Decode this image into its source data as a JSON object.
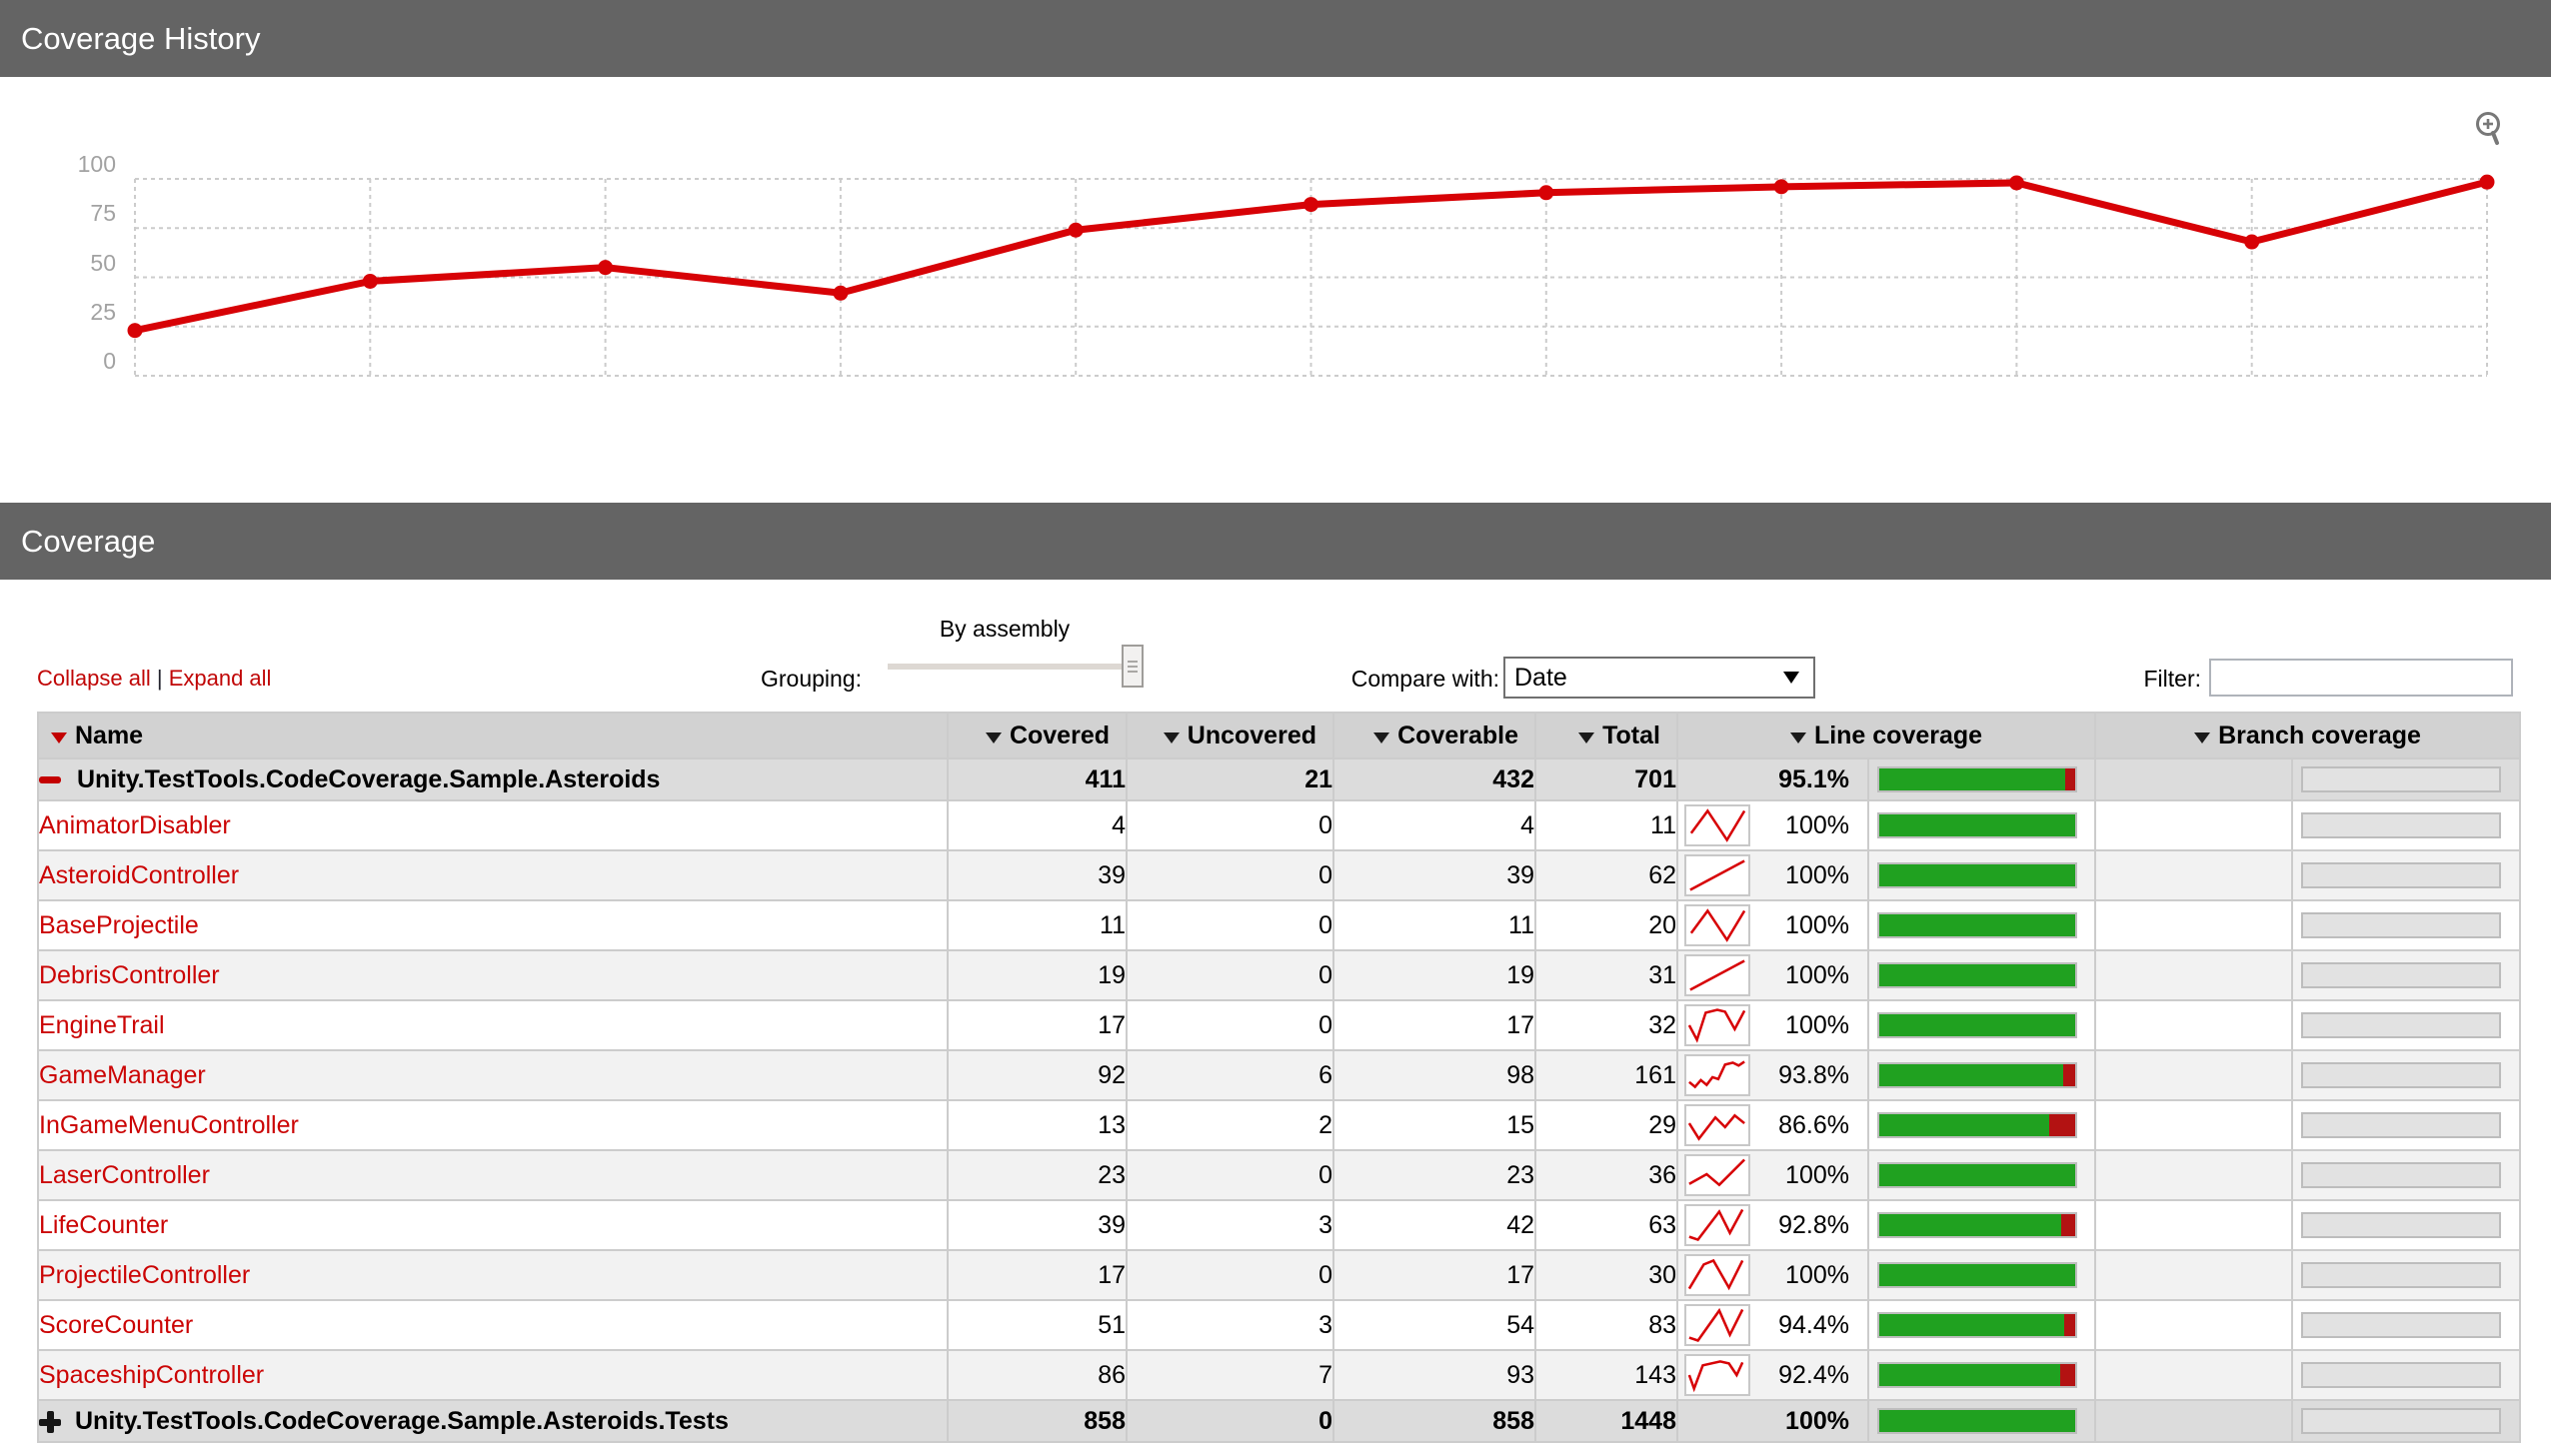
{
  "history_section": {
    "title": "Coverage History",
    "zoom_icon": "magnifier-plus"
  },
  "chart_data": {
    "type": "line",
    "title": "Coverage History",
    "series": [
      {
        "name": "coverage-percent",
        "values": [
          23,
          48,
          55,
          42,
          74,
          87,
          93,
          96,
          98,
          68,
          98.4
        ]
      }
    ],
    "yticks": [
      100,
      75,
      50,
      25,
      0
    ],
    "ylim": [
      0,
      100
    ],
    "grid": "dashed",
    "legend": "none",
    "line_color": "#d70206"
  },
  "coverage_section": {
    "title": "Coverage"
  },
  "controls": {
    "collapse_all": "Collapse all",
    "separator": "|",
    "expand_all": "Expand all",
    "grouping_label": "Grouping:",
    "grouping_value": "By assembly",
    "compare_label": "Compare with:",
    "compare_value": "Date",
    "filter_label": "Filter:",
    "filter_value": ""
  },
  "colors": {
    "accent_red": "#cb0505",
    "bar_green": "#20a120",
    "bar_red": "#b31212",
    "header_gray": "#646464"
  },
  "table": {
    "columns": [
      {
        "label": "Name",
        "sorted": true,
        "colspan": 1,
        "align": "left"
      },
      {
        "label": "Covered",
        "sorted": false,
        "colspan": 1,
        "align": "right"
      },
      {
        "label": "Uncovered",
        "sorted": false,
        "colspan": 1,
        "align": "right"
      },
      {
        "label": "Coverable",
        "sorted": false,
        "colspan": 1,
        "align": "right"
      },
      {
        "label": "Total",
        "sorted": false,
        "colspan": 1,
        "align": "right"
      },
      {
        "label": "Line coverage",
        "sorted": false,
        "colspan": 2,
        "align": "center"
      },
      {
        "label": "Branch coverage",
        "sorted": false,
        "colspan": 2,
        "align": "center"
      }
    ],
    "rows": [
      {
        "name": "Unity.TestTools.CodeCoverage.Sample.Asteroids",
        "type": "assembly",
        "icon": "minus",
        "covered": "411",
        "uncovered": "21",
        "coverable": "432",
        "total": "701",
        "line_coverage": "95.1%",
        "line_pct": 95.1,
        "spark": null,
        "branch_pct": null
      },
      {
        "name": "AnimatorDisabler",
        "type": "class",
        "icon": null,
        "covered": "4",
        "uncovered": "0",
        "coverable": "4",
        "total": "11",
        "line_coverage": "100%",
        "line_pct": 100,
        "spark": "5,27 22,4 42,34 60,4",
        "branch_pct": null
      },
      {
        "name": "AsteroidController",
        "type": "class",
        "icon": null,
        "covered": "39",
        "uncovered": "0",
        "coverable": "39",
        "total": "62",
        "line_coverage": "100%",
        "line_pct": 100,
        "spark": "4,34 60,4",
        "branch_pct": null
      },
      {
        "name": "BaseProjectile",
        "type": "class",
        "icon": null,
        "covered": "11",
        "uncovered": "0",
        "coverable": "11",
        "total": "20",
        "line_coverage": "100%",
        "line_pct": 100,
        "spark": "5,27 22,4 42,34 60,4",
        "branch_pct": null
      },
      {
        "name": "DebrisController",
        "type": "class",
        "icon": null,
        "covered": "19",
        "uncovered": "0",
        "coverable": "19",
        "total": "31",
        "line_coverage": "100%",
        "line_pct": 100,
        "spark": "4,34 60,4",
        "branch_pct": null
      },
      {
        "name": "EngineTrail",
        "type": "class",
        "icon": null,
        "covered": "17",
        "uncovered": "0",
        "coverable": "17",
        "total": "32",
        "line_coverage": "100%",
        "line_pct": 100,
        "spark": "3,19 11,34 20,6 32,3 40,5 50,23 60,4",
        "branch_pct": null
      },
      {
        "name": "GameManager",
        "type": "class",
        "icon": null,
        "covered": "92",
        "uncovered": "6",
        "coverable": "98",
        "total": "161",
        "line_coverage": "93.8%",
        "line_pct": 93.8,
        "spark": "3,26 9,31 15,24 21,29 27,21 33,23 40,8 48,6 54,9 60,5",
        "branch_pct": null
      },
      {
        "name": "InGameMenuController",
        "type": "class",
        "icon": null,
        "covered": "13",
        "uncovered": "2",
        "coverable": "15",
        "total": "29",
        "line_coverage": "86.6%",
        "line_pct": 86.6,
        "spark": "3,17 13,33 30,11 40,21 50,9 60,17",
        "branch_pct": null
      },
      {
        "name": "LaserController",
        "type": "class",
        "icon": null,
        "covered": "23",
        "uncovered": "0",
        "coverable": "23",
        "total": "36",
        "line_coverage": "100%",
        "line_pct": 100,
        "spark": "3,28 21,18 34,29 60,3",
        "branch_pct": null
      },
      {
        "name": "LifeCounter",
        "type": "class",
        "icon": null,
        "covered": "39",
        "uncovered": "3",
        "coverable": "42",
        "total": "63",
        "line_coverage": "92.8%",
        "line_pct": 92.8,
        "spark": "3,31 12,34 34,5 45,27 58,3",
        "branch_pct": null
      },
      {
        "name": "ProjectileController",
        "type": "class",
        "icon": null,
        "covered": "17",
        "uncovered": "0",
        "coverable": "17",
        "total": "30",
        "line_coverage": "100%",
        "line_pct": 100,
        "spark": "3,33 18,8 28,4 44,32 58,4",
        "branch_pct": null
      },
      {
        "name": "ScoreCounter",
        "type": "class",
        "icon": null,
        "covered": "51",
        "uncovered": "3",
        "coverable": "54",
        "total": "83",
        "line_coverage": "94.4%",
        "line_pct": 94.4,
        "spark": "3,32 12,35 34,4 45,29 58,3",
        "branch_pct": null
      },
      {
        "name": "SpaceshipController",
        "type": "class",
        "icon": null,
        "covered": "86",
        "uncovered": "7",
        "coverable": "93",
        "total": "143",
        "line_coverage": "92.4%",
        "line_pct": 92.4,
        "spark": "3,19 8,33 17,9 35,5 44,7 52,19 58,6",
        "branch_pct": null
      },
      {
        "name": "Unity.TestTools.CodeCoverage.Sample.Asteroids.Tests",
        "type": "assembly",
        "icon": "plus",
        "covered": "858",
        "uncovered": "0",
        "coverable": "858",
        "total": "1448",
        "line_coverage": "100%",
        "line_pct": 100,
        "spark": null,
        "branch_pct": null
      }
    ]
  }
}
